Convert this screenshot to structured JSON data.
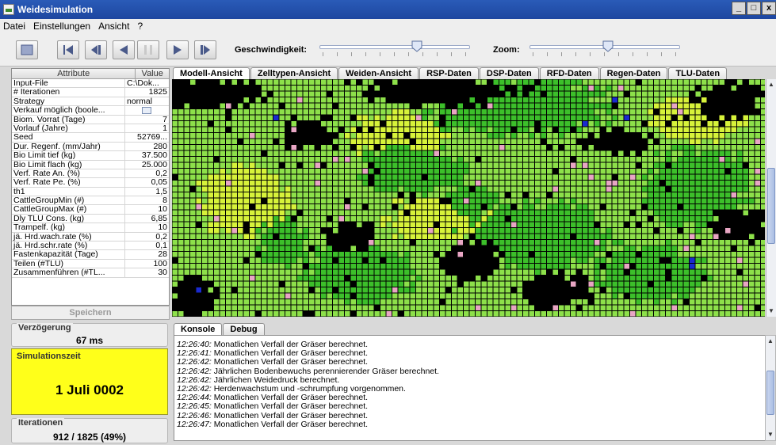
{
  "window": {
    "title": "Weidesimulation",
    "minimize": "_",
    "maximize": "□",
    "close": "x"
  },
  "menu": [
    "Datei",
    "Einstellungen",
    "Ansicht",
    "?"
  ],
  "toolbar": {
    "buttons": [
      "stop-icon",
      "skip-to-start-icon",
      "step-back-icon",
      "play-back-icon",
      "pause-icon",
      "play-icon",
      "step-forward-icon"
    ],
    "speed_label": "Geschwindigkeit:",
    "speed_value": 0.66,
    "zoom_label": "Zoom:",
    "zoom_value": 0.52
  },
  "attributes": {
    "header_attribute": "Attribute",
    "header_value": "Value",
    "rows": [
      {
        "name": "Input-File",
        "value": "C:\\Dok..."
      },
      {
        "name": "# Iterationen",
        "value": "1825"
      },
      {
        "name": "Strategy",
        "value": "normal"
      },
      {
        "name": "Verkauf möglich (boole...",
        "value": ""
      },
      {
        "name": "Biom. Vorrat (Tage)",
        "value": "7"
      },
      {
        "name": "Vorlauf (Jahre)",
        "value": "1"
      },
      {
        "name": "Seed",
        "value": "52769..."
      },
      {
        "name": "Dur. Regenf. (mm/Jahr)",
        "value": "280"
      },
      {
        "name": "Bio Limit tief (kg)",
        "value": "37.500"
      },
      {
        "name": "Bio Limit flach (kg)",
        "value": "25.000"
      },
      {
        "name": "Verf. Rate An. (%)",
        "value": "0,2"
      },
      {
        "name": "Verf. Rate Pe. (%)",
        "value": "0,05"
      },
      {
        "name": "th1",
        "value": "1,5"
      },
      {
        "name": "CattleGroupMin (#)",
        "value": "8"
      },
      {
        "name": "CattleGroupMax (#)",
        "value": "10"
      },
      {
        "name": "Dly TLU Cons. (kg)",
        "value": "6,85"
      },
      {
        "name": "Trampelf. (kg)",
        "value": "10"
      },
      {
        "name": "jä. Hrd.wach.rate (%)",
        "value": "0,2"
      },
      {
        "name": "jä. Hrd.schr.rate (%)",
        "value": "0,1"
      },
      {
        "name": "Fastenkapazität (Tage)",
        "value": "28"
      },
      {
        "name": "Teilen (#TLU)",
        "value": "100"
      },
      {
        "name": "Zusammenführen (#TL...",
        "value": "30"
      }
    ],
    "save_label": "Speichern"
  },
  "status": {
    "delay_label": "Verzögerung",
    "delay_value": "67 ms",
    "simtime_label": "Simulationszeit",
    "simtime_value": "1 Juli 0002",
    "iter_label": "Iterationen",
    "iter_value": "912 / 1825 (49%)"
  },
  "view_tabs": [
    "Modell-Ansicht",
    "Zelltypen-Ansicht",
    "Weiden-Ansicht",
    "RSP-Daten",
    "DSP-Daten",
    "RFD-Daten",
    "Regen-Daten",
    "TLU-Daten"
  ],
  "console": {
    "tabs": [
      "Konsole",
      "Debug"
    ],
    "lines": [
      {
        "time": "12:26:40:",
        "text": " Monatlichen Verfall der Gräser berechnet."
      },
      {
        "time": "12:26:41:",
        "text": " Monatlichen Verfall der Gräser berechnet."
      },
      {
        "time": "12:26:42:",
        "text": " Monatlichen Verfall der Gräser berechnet."
      },
      {
        "time": "12:26:42:",
        "text": " Jährlichen Bodenbewuchs perennierender Gräser berechnet."
      },
      {
        "time": "12:26:42:",
        "text": " Jährlichen Weidedruck berechnet."
      },
      {
        "time": "12:26:42:",
        "text": " Herdenwachstum und -schrumpfung vorgenommen."
      },
      {
        "time": "12:26:44:",
        "text": " Monatlichen Verfall der Gräser berechnet."
      },
      {
        "time": "12:26:45:",
        "text": " Monatlichen Verfall der Gräser berechnet."
      },
      {
        "time": "12:26:46:",
        "text": " Monatlichen Verfall der Gräser berechnet."
      },
      {
        "time": "12:26:47:",
        "text": " Monatlichen Verfall der Gräser berechnet."
      }
    ]
  },
  "colors": {
    "grass_light": "#8de04a",
    "grass_dark": "#3cbf2a",
    "grass_yellow": "#d7f23a",
    "bare": "#000000",
    "pink": "#e8a6c4",
    "blue": "#1a2acf",
    "simtime_bg": "#ffff1a"
  }
}
